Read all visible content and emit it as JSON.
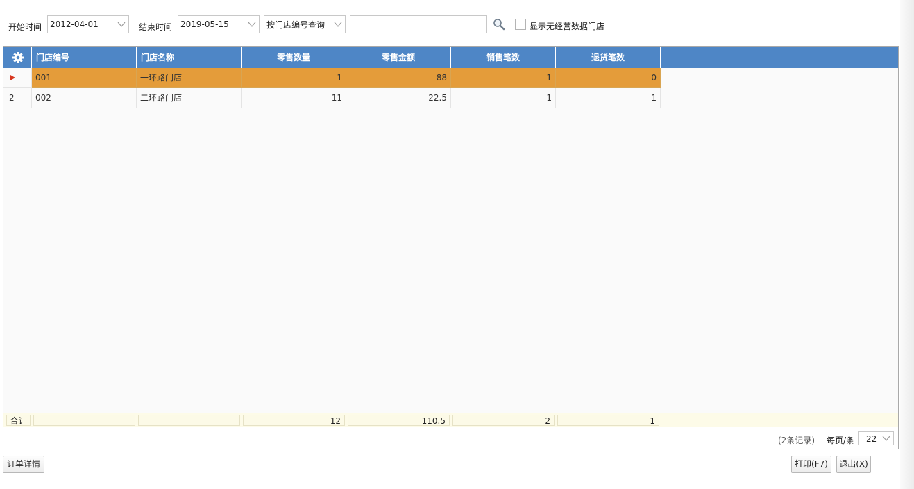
{
  "toolbar": {
    "start_label": "开始时间",
    "start_value": "2012-04-01",
    "end_label": "结束时间",
    "end_value": "2019-05-15",
    "query_mode": "按门店编号查询",
    "search_value": "",
    "show_empty_label": "显示无经营数据门店",
    "show_empty_checked": false
  },
  "grid": {
    "columns": [
      "门店编号",
      "门店名称",
      "零售数量",
      "零售金额",
      "销售笔数",
      "退货笔数"
    ],
    "rows": [
      {
        "index": "",
        "selected": true,
        "cells": [
          "001",
          "一环路门店",
          "1",
          "88",
          "1",
          "0"
        ]
      },
      {
        "index": "2",
        "selected": false,
        "cells": [
          "002",
          "二环路门店",
          "11",
          "22.5",
          "1",
          "1"
        ]
      }
    ],
    "footer": {
      "label": "合计",
      "cells": [
        "",
        "",
        "12",
        "110.5",
        "2",
        "1"
      ]
    }
  },
  "pager": {
    "record_count": "(2条记录)",
    "per_page_label": "每页/条",
    "per_page_value": "22"
  },
  "buttons": {
    "order_detail": "订单详情",
    "print": "打印(F7)",
    "exit": "退出(X)"
  },
  "colors": {
    "header_bg": "#4e86c6",
    "selected_row_bg": "#e49c3a",
    "footer_bg": "#fdfbe8",
    "selection_arrow": "#d7371f"
  }
}
